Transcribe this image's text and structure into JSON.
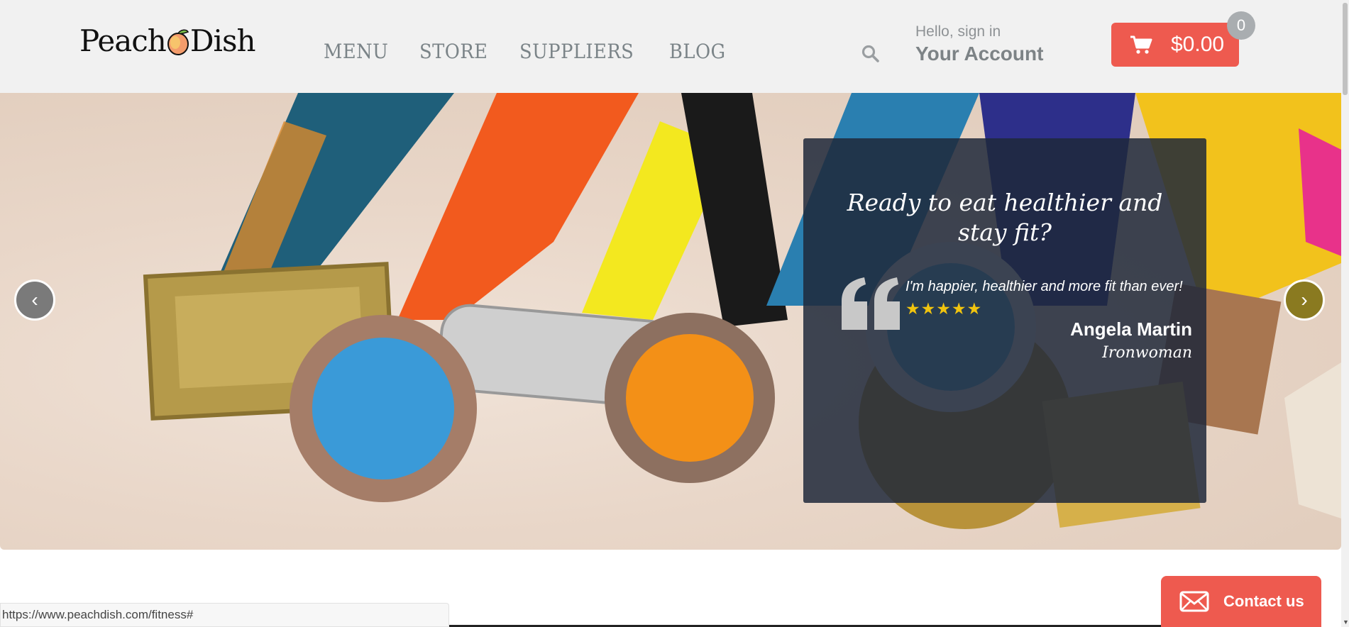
{
  "brand": {
    "logo_text_left": "Peach",
    "logo_text_right": "Dish"
  },
  "nav": {
    "items": [
      "MENU",
      "STORE",
      "SUPPLIERS",
      "BLOG"
    ]
  },
  "account": {
    "greeting": "Hello, sign in",
    "label": "Your Account"
  },
  "cart": {
    "amount": "$0.00",
    "count": "0"
  },
  "hero": {
    "quote_title": "Ready to eat healthier and stay fit?",
    "quote_text": "I'm happier, healthier and more fit than ever!",
    "rating_stars": 5,
    "author": "Angela Martin",
    "role": "Ironwoman",
    "prev_arrow": "‹",
    "next_arrow": "›"
  },
  "status_bar": {
    "url": "https://www.peachdish.com/fitness#"
  },
  "contact": {
    "label": "Contact us"
  },
  "colors": {
    "accent": "#ee5a4f",
    "header_bg": "#f1f1f1",
    "panel_bg": "#1e283a",
    "star": "#f1c40f"
  }
}
